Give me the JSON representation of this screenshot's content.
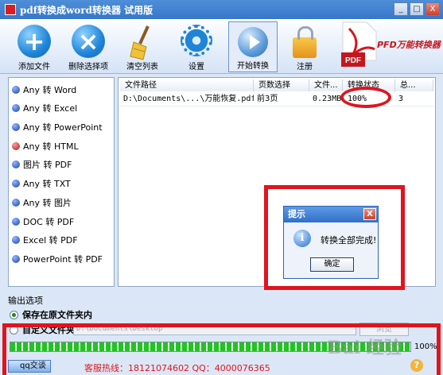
{
  "window": {
    "title": "pdf转换成word转换器  试用版",
    "minimize": "_",
    "maximize": "□",
    "close": "X"
  },
  "toolbar": {
    "buttons": [
      {
        "label": "添加文件"
      },
      {
        "label": "删除选择项"
      },
      {
        "label": "清空列表"
      },
      {
        "label": "设置"
      },
      {
        "label": "开始转换"
      },
      {
        "label": "注册"
      }
    ],
    "brand_text": "PFD万能转换器",
    "logo_text": "PDF"
  },
  "conversions": [
    "Any 转 Word",
    "Any 转 Excel",
    "Any 转 PowerPoint",
    "Any 转 HTML",
    "图片 转 PDF",
    "Any 转 TXT",
    "Any 转 图片",
    "DOC 转 PDF",
    "Excel 转 PDF",
    "PowerPoint 转 PDF"
  ],
  "table": {
    "headers": [
      "文件路径",
      "页数选择",
      "文件...",
      "转换状态",
      "总..."
    ],
    "rows": [
      {
        "path": "D:\\Documents\\...\\万能恢复.pdf",
        "pages": "前3页",
        "size": "0.23MB",
        "status": "100%",
        "total": "3"
      }
    ]
  },
  "dialog": {
    "title": "提示",
    "message": "转换全部完成!",
    "ok": "确定",
    "icon_glyph": "i"
  },
  "output": {
    "label": "输出选项",
    "opt_same_folder": "保存在原文件夹内",
    "opt_custom": "自定义文件夹",
    "custom_path": "D:\\Documents\\Desktop",
    "browse": "浏览"
  },
  "progress": {
    "value": 100,
    "text": "100%"
  },
  "footer": {
    "qq_label": "qq交谈",
    "contact": "客服热线：18121074602  QQ：4000076365",
    "help": "?"
  },
  "watermark": "Bai 经验",
  "colors": {
    "highlight_red": "#e0141d",
    "progress_green": "#22c322"
  }
}
